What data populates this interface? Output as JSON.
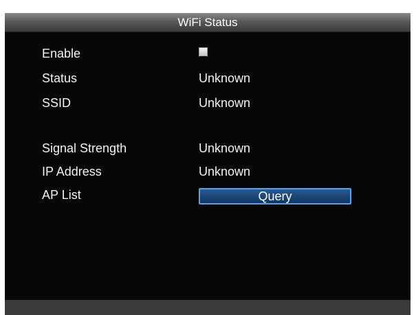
{
  "window": {
    "title": "WiFi Status"
  },
  "fields": {
    "enable": {
      "label": "Enable",
      "checked": false
    },
    "status": {
      "label": "Status",
      "value": "Unknown"
    },
    "ssid": {
      "label": "SSID",
      "value": "Unknown"
    },
    "signal_strength": {
      "label": "Signal Strength",
      "value": "Unknown"
    },
    "ip_address": {
      "label": "IP Address",
      "value": "Unknown"
    },
    "ap_list": {
      "label": "AP List",
      "button_label": "Query"
    }
  },
  "colors": {
    "background": "#070707",
    "titlebar": "#5a5a5a",
    "button_fill": "#1b4677",
    "button_border": "#5aa0e6",
    "text": "#f2f2f2"
  }
}
